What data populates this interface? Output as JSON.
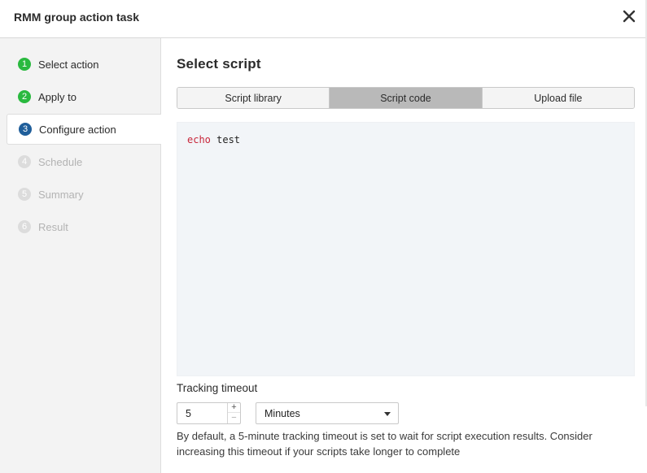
{
  "dialog": {
    "title": "RMM group action task"
  },
  "steps": [
    {
      "number": "1",
      "label": "Select action",
      "state": "done"
    },
    {
      "number": "2",
      "label": "Apply to",
      "state": "done"
    },
    {
      "number": "3",
      "label": "Configure action",
      "state": "current"
    },
    {
      "number": "4",
      "label": "Schedule",
      "state": "pending"
    },
    {
      "number": "5",
      "label": "Summary",
      "state": "pending"
    },
    {
      "number": "6",
      "label": "Result",
      "state": "pending"
    }
  ],
  "main": {
    "heading": "Select script",
    "tabs": [
      {
        "label": "Script library",
        "active": false
      },
      {
        "label": "Script code",
        "active": true
      },
      {
        "label": "Upload file",
        "active": false
      }
    ],
    "code": {
      "keyword": "echo",
      "argument": " test"
    },
    "tracking": {
      "label": "Tracking timeout",
      "value": "5",
      "stepper_up": "+",
      "stepper_down": "−",
      "unit": "Minutes",
      "help": "By default, a 5-minute tracking timeout is set to wait for script execution results. Consider increasing this timeout if your scripts take longer to complete"
    }
  },
  "colors": {
    "done": "#2ab93f",
    "current": "#1f5e9a",
    "pending": "#dcdcdc",
    "active_tab": "#b9b9b9",
    "code_bg": "#f2f5f8",
    "keyword": "#c8263a"
  }
}
